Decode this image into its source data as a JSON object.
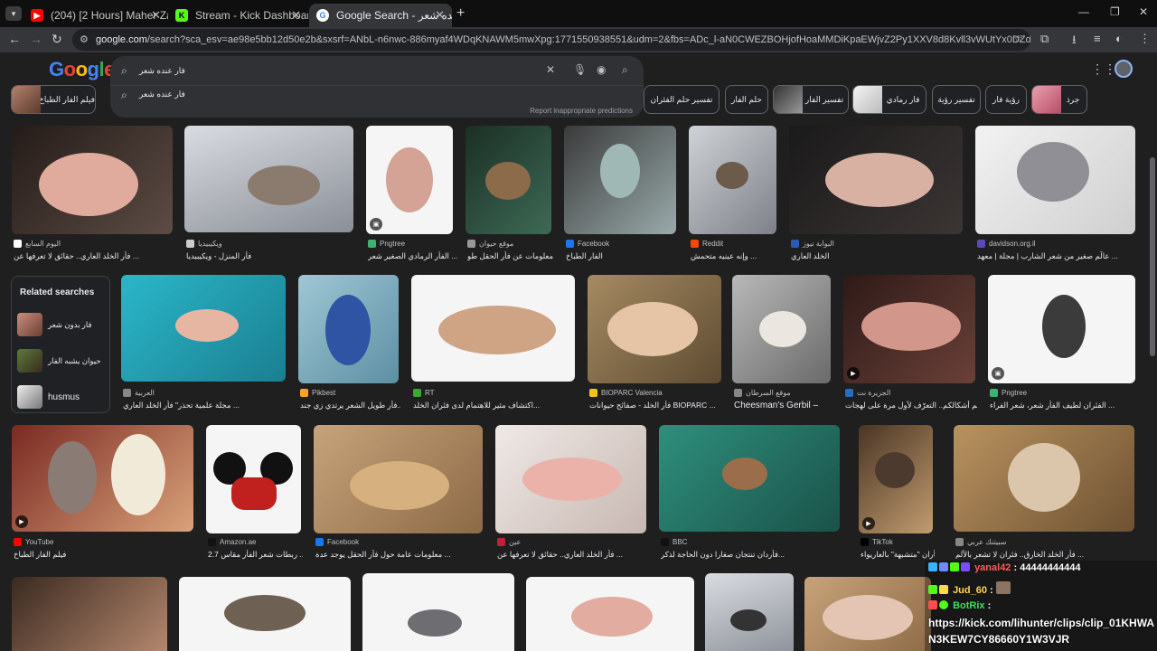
{
  "browser": {
    "tabs": [
      {
        "label": "(204) [2 Hours] Maher Zain",
        "active": false
      },
      {
        "label": "Stream - Kick Dashboard",
        "active": false
      },
      {
        "label": "Google Search - فار عنده شعر",
        "active": true
      }
    ],
    "tab_list_icon": "chevron-down-icon",
    "new_tab": "+",
    "url_host": "google.com",
    "url_rest": "/search?sca_esv=ae98e5bb12d50e2b&sxsrf=ANbL-n6nwc-886myaf4WDqKNAWM5mwXpg:1771550938551&udm=2&fbs=ADc_l-aN0CWEZBOHjofHoaMMDiKpaEWjvZ2Py1XXV8d8Kvll3vWUtYx0DZdicpfE1faYemg2KC4yuMPyQIlvl...",
    "window_controls": [
      "—",
      "❐",
      "✕"
    ]
  },
  "search": {
    "logo": "Google",
    "query": "فار عنده شعر",
    "suggestion": "فار عنده شعر",
    "report": "Report inappropriate predictions"
  },
  "chips": [
    {
      "label": "فيلم الفار الطباخ"
    },
    {
      "label": "تفسير حلم الفئران"
    },
    {
      "label": "حلم الفار"
    },
    {
      "label": "تفسير الفار"
    },
    {
      "label": "فار رمادي"
    },
    {
      "label": "تفسير رؤية"
    },
    {
      "label": "رؤية فار"
    },
    {
      "label": "جرذ"
    }
  ],
  "row1": [
    {
      "source": "اليوم السابع",
      "caption": "فأر الخلد العاري.. حقائق لا تعرفها عن ..."
    },
    {
      "source": "ويكيبيديا",
      "caption": "فأر المنزل - ويكيبيديا"
    },
    {
      "source": "Pngtree",
      "caption": "الفأر الرمادي الصغير شعر ..."
    },
    {
      "source": "موقع حيوان",
      "caption": "معلومات عن فأر الحقل طو..."
    },
    {
      "source": "Facebook",
      "caption": "الفار الطباخ"
    },
    {
      "source": "Reddit",
      "caption": "وإنه عينيه متحمش ..."
    },
    {
      "source": "البوابة نيوز",
      "caption": "الخلد العاري"
    },
    {
      "source": "davidson.org.il",
      "caption": "عالَم صغير من شعر الشارب | مجلة | معهد ..."
    }
  ],
  "related": {
    "title": "Related searches",
    "items": [
      {
        "label": "فار بدون شعر"
      },
      {
        "label": "حيوان يشبه الفار"
      },
      {
        "label": "husmus"
      }
    ]
  },
  "row2": [
    {
      "source": "العربية",
      "caption": "مجلة علمية تحذر\" فأر الخلد العاري ..."
    },
    {
      "source": "Pikbest",
      "caption": "فأر طويل الشعر يرتدي زي جند..."
    },
    {
      "source": "RT",
      "caption": "اكتشاف مثير للاهتمام لدى فئران الخلد..."
    },
    {
      "source": "BIOPARC Valencia",
      "caption": "فأر الخلد - صفائح حيوانات BIOPARC ..."
    },
    {
      "source": "موقع السرطان",
      "caption": "Cheesman's Gerbil –"
    },
    {
      "source": "الجزيرة نت",
      "caption": "أسم أشكالكم.. التعرّف لأول مرة على لهجات ..."
    },
    {
      "source": "Pngtree",
      "caption": "الفئران لطيف الفأر شعر، شعر الفراء ..."
    }
  ],
  "row3": [
    {
      "source": "YouTube",
      "caption": "فيلم الفار الطباخ"
    },
    {
      "source": "Amazon.ae",
      "caption": "ربطات شعر الفأر مقاس 2.7 ..."
    },
    {
      "source": "Facebook",
      "caption": "معلومات عامة حول فأر الحقل يوجد عدة ..."
    },
    {
      "source": "عين",
      "caption": "فأر الخلد العاري.. حقائق لا تعرفها عن ..."
    },
    {
      "source": "BBC",
      "caption": "فأردان تنتجان صغارا دون الحاجة لذكر..."
    },
    {
      "source": "TikTok",
      "caption": "فأران \"متشبهة\" بالعاريواء..."
    },
    {
      "source": "سبيتنك عربي",
      "caption": "فأر الخلد الخارق.. فئران لا تشعر بالألم ..."
    }
  ],
  "chat": {
    "line1_user": "yanal42",
    "line1_msg": ": 44444444444",
    "line2_user": "Jud_60",
    "line2_msg": ":",
    "line3_user": "BotRix",
    "line3_msg": ":",
    "link1": "https://kick.com/lihunter/clips/clip_01KHWA",
    "link2": "N3KEW7CY86660Y1W3VJR"
  },
  "colors": {
    "background": "#1f1f1f",
    "search_box": "#303134",
    "accent": "#8ab4f8"
  }
}
